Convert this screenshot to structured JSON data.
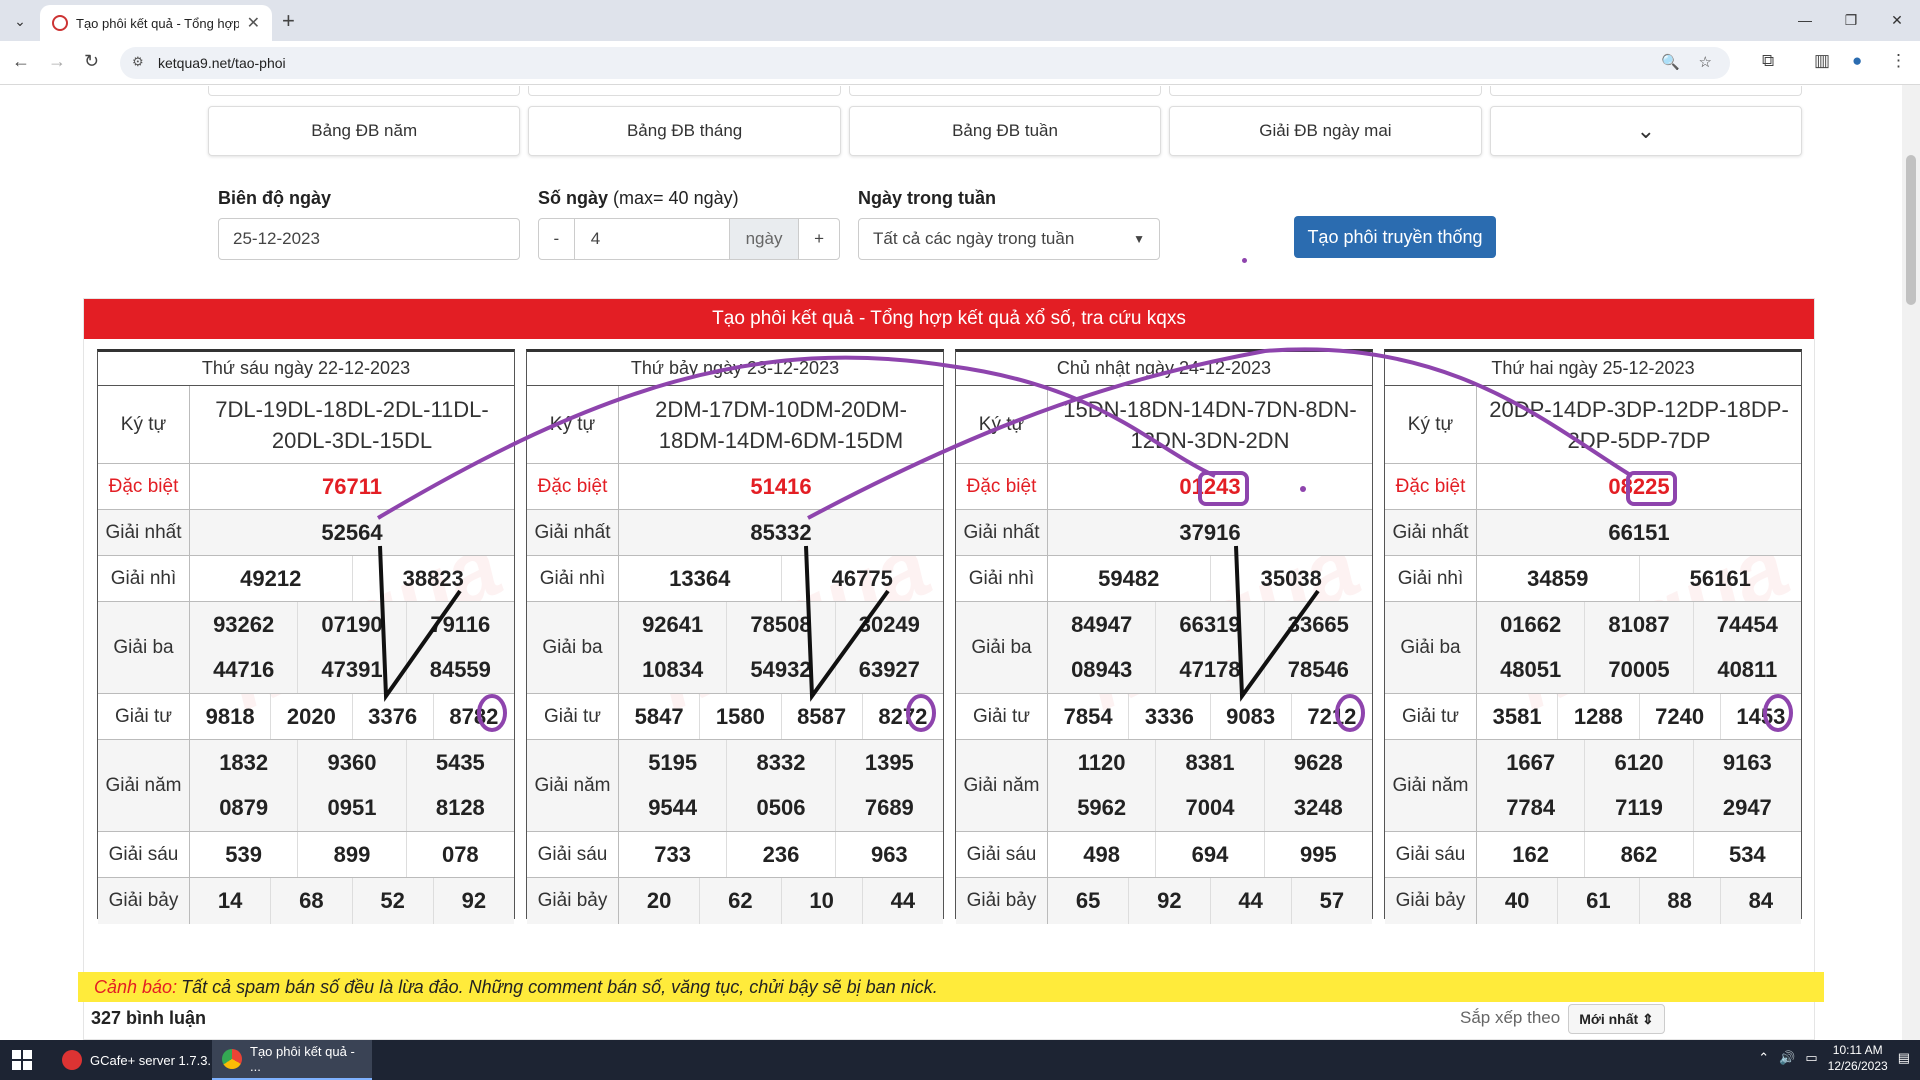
{
  "browser": {
    "tab_title": "Tạo phôi kết quả - Tổng hợp k",
    "url": "ketqua9.net/tao-phoi"
  },
  "quick_buttons": [
    "Bảng ĐB năm",
    "Bảng ĐB tháng",
    "Bảng ĐB tuần",
    "Giải ĐB ngày mai",
    "⌄"
  ],
  "form": {
    "range_label": "Biên độ ngày",
    "range_value": "25-12-2023",
    "days_label": "Số ngày",
    "days_hint": "(max= 40 ngày)",
    "days_minus": "-",
    "days_value": "4",
    "days_unit": "ngày",
    "days_plus": "+",
    "weekday_label": "Ngày trong tuần",
    "weekday_value": "Tất cả các ngày trong tuần",
    "submit_label": "Tạo phôi truyền thống"
  },
  "banner": "Tạo phôi kết quả - Tổng hợp kết quả xổ số, tra cứu kqxs",
  "labels": {
    "kytu": "Ký tự",
    "db": "Đặc biệt",
    "g1": "Giải nhất",
    "g2": "Giải nhì",
    "g3": "Giải ba",
    "g4": "Giải tư",
    "g5": "Giải năm",
    "g6": "Giải sáu",
    "g7": "Giải bảy"
  },
  "cards": [
    {
      "date": "Thứ sáu ngày 22-12-2023",
      "kytu": "7DL-19DL-18DL-2DL-11DL-20DL-3DL-15DL",
      "db": "76711",
      "g1": "52564",
      "g2": [
        "49212",
        "38823"
      ],
      "g3a": [
        "93262",
        "07190",
        "79116"
      ],
      "g3b": [
        "44716",
        "47391",
        "84559"
      ],
      "g4": [
        "9818",
        "2020",
        "3376",
        "8782"
      ],
      "g5a": [
        "1832",
        "9360",
        "5435"
      ],
      "g5b": [
        "0879",
        "0951",
        "8128"
      ],
      "g6": [
        "539",
        "899",
        "078"
      ],
      "g7": [
        "14",
        "68",
        "52",
        "92"
      ]
    },
    {
      "date": "Thứ bảy ngày 23-12-2023",
      "kytu": "2DM-17DM-10DM-20DM-18DM-14DM-6DM-15DM",
      "db": "51416",
      "g1": "85332",
      "g2": [
        "13364",
        "46775"
      ],
      "g3a": [
        "92641",
        "78508",
        "30249"
      ],
      "g3b": [
        "10834",
        "54932",
        "63927"
      ],
      "g4": [
        "5847",
        "1580",
        "8587",
        "8272"
      ],
      "g5a": [
        "5195",
        "8332",
        "1395"
      ],
      "g5b": [
        "9544",
        "0506",
        "7689"
      ],
      "g6": [
        "733",
        "236",
        "963"
      ],
      "g7": [
        "20",
        "62",
        "10",
        "44"
      ]
    },
    {
      "date": "Chủ nhật ngày 24-12-2023",
      "kytu": "15DN-18DN-14DN-7DN-8DN-12DN-3DN-2DN",
      "db": "01243",
      "g1": "37916",
      "g2": [
        "59482",
        "35038"
      ],
      "g3a": [
        "84947",
        "66319",
        "33665"
      ],
      "g3b": [
        "08943",
        "47178",
        "78546"
      ],
      "g4": [
        "7854",
        "3336",
        "9083",
        "7212"
      ],
      "g5a": [
        "1120",
        "8381",
        "9628"
      ],
      "g5b": [
        "5962",
        "7004",
        "3248"
      ],
      "g6": [
        "498",
        "694",
        "995"
      ],
      "g7": [
        "65",
        "92",
        "44",
        "57"
      ]
    },
    {
      "date": "Thứ hai ngày 25-12-2023",
      "kytu": "20DP-14DP-3DP-12DP-18DP-2DP-5DP-7DP",
      "db": "08225",
      "g1": "66151",
      "g2": [
        "34859",
        "56161"
      ],
      "g3a": [
        "01662",
        "81087",
        "74454"
      ],
      "g3b": [
        "48051",
        "70005",
        "40811"
      ],
      "g4": [
        "3581",
        "1288",
        "7240",
        "1453"
      ],
      "g5a": [
        "1667",
        "6120",
        "9163"
      ],
      "g5b": [
        "7784",
        "7119",
        "2947"
      ],
      "g6": [
        "162",
        "862",
        "534"
      ],
      "g7": [
        "40",
        "61",
        "88",
        "84"
      ]
    }
  ],
  "warning": {
    "label": "Cảnh báo:",
    "text": "Tất cả spam bán số đều là lừa đảo. Những comment bán số, văng tục, chửi bậy sẽ bị ban nick."
  },
  "comments": {
    "count": "327 bình luận",
    "sort_label": "Sắp xếp theo",
    "sort_value": "Mới nhất ⇕"
  },
  "taskbar": {
    "app1": "GCafe+ server 1.7.3...",
    "app2": "Tạo phôi kết quả - ...",
    "time": "10:11 AM",
    "date": "12/26/2023"
  },
  "colors": {
    "banner": "#e31e24",
    "primary_button": "#2b6cb0",
    "warning_bg": "#ffeb3b",
    "annotation_purple": "#8e44ad"
  }
}
